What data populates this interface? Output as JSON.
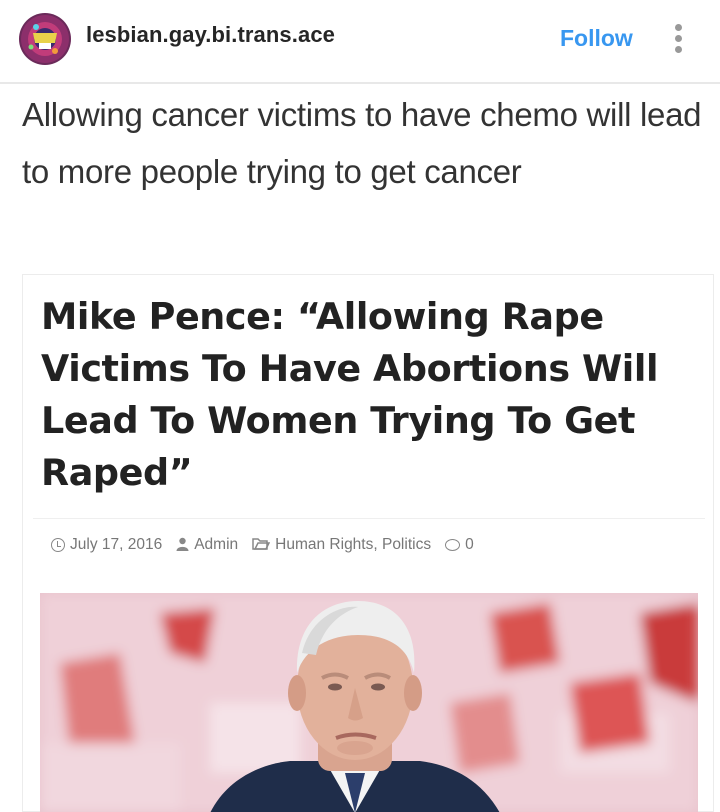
{
  "post": {
    "username": "lesbian.gay.bi.trans.ace",
    "follow_label": "Follow",
    "caption": "Allowing cancer victims to have chemo will lead to more people trying to get cancer"
  },
  "article": {
    "headline": "Mike Pence: “Allowing Rape Victims To Have Abortions Will Lead To Women Trying To Get Raped”",
    "date": "July 17, 2016",
    "author": "Admin",
    "categories": "Human Rights, Politics",
    "comments": "0"
  },
  "colors": {
    "follow": "#3897f0",
    "text": "#262626",
    "photo_background": "#e8c2cc",
    "photo_accent": "#d9534f",
    "suit": "#1f2d4a"
  },
  "icons": {
    "more": "more-options-icon",
    "date": "clock-icon",
    "author": "user-icon",
    "category": "folder-icon",
    "comments": "comment-icon"
  }
}
